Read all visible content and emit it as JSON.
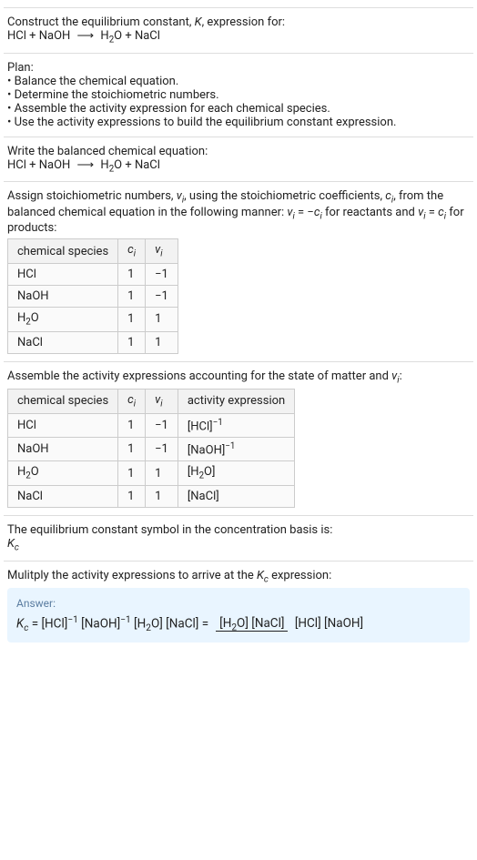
{
  "intro": {
    "line1": "Construct the equilibrium constant, ",
    "k_sym": "K",
    "line1b": ", expression for:",
    "equation_lhs_1": "HCl + NaOH",
    "equation_arrow": "⟶",
    "equation_rhs_1": "H",
    "equation_rhs_2": "2",
    "equation_rhs_3": "O + NaCl"
  },
  "plan": {
    "title": "Plan:",
    "item1": "• Balance the chemical equation.",
    "item2": "• Determine the stoichiometric numbers.",
    "item3": "• Assemble the activity expression for each chemical species.",
    "item4": "• Use the activity expressions to build the equilibrium constant expression."
  },
  "balanced": {
    "title": "Write the balanced chemical equation:",
    "lhs": "HCl + NaOH",
    "arrow": "⟶",
    "rhs_1": "H",
    "rhs_2": "2",
    "rhs_3": "O + NaCl"
  },
  "stoich": {
    "text1": "Assign stoichiometric numbers, ",
    "nu": "ν",
    "i": "i",
    "text2": ", using the stoichiometric coefficients, ",
    "c": "c",
    "text3": ", from the balanced chemical equation in the following manner: ",
    "eq1_l": "ν",
    "eq1_eq": " = −",
    "eq1_r": "c",
    "text4": " for reactants and ",
    "eq2_l": "ν",
    "eq2_eq": " = ",
    "eq2_r": "c",
    "text5": " for products:"
  },
  "table1": {
    "h1": "chemical species",
    "h2": "c",
    "h2i": "i",
    "h3": "ν",
    "h3i": "i",
    "rows": [
      {
        "sp": "HCl",
        "c": "1",
        "v": "−1"
      },
      {
        "sp": "NaOH",
        "c": "1",
        "v": "−1"
      },
      {
        "sp_h": "H",
        "sp_2": "2",
        "sp_o": "O",
        "c": "1",
        "v": "1"
      },
      {
        "sp": "NaCl",
        "c": "1",
        "v": "1"
      }
    ]
  },
  "assemble": {
    "text1": "Assemble the activity expressions accounting for the state of matter and ",
    "nu": "ν",
    "i": "i",
    "text2": ":"
  },
  "table2": {
    "h1": "chemical species",
    "h2": "c",
    "h2i": "i",
    "h3": "ν",
    "h3i": "i",
    "h4": "activity expression",
    "rows": [
      {
        "sp": "HCl",
        "c": "1",
        "v": "−1",
        "ae_base": "[HCl]",
        "ae_exp": "−1"
      },
      {
        "sp": "NaOH",
        "c": "1",
        "v": "−1",
        "ae_base": "[NaOH]",
        "ae_exp": "−1"
      },
      {
        "sp_h": "H",
        "sp_2": "2",
        "sp_o": "O",
        "c": "1",
        "v": "1",
        "ae_base": "[H",
        "ae_sub": "2",
        "ae_base2": "O]"
      },
      {
        "sp": "NaCl",
        "c": "1",
        "v": "1",
        "ae_base": "[NaCl]"
      }
    ]
  },
  "kc_symbol": {
    "text": "The equilibrium constant symbol in the concentration basis is:",
    "k": "K",
    "c": "c"
  },
  "multiply": {
    "text1": "Mulitply the activity expressions to arrive at the ",
    "k": "K",
    "c": "c",
    "text2": " expression:"
  },
  "answer": {
    "label": "Answer:",
    "k": "K",
    "c": "c",
    "eq": " = ",
    "t1": "[HCl]",
    "e1": "−1",
    "sp": " ",
    "t2": "[NaOH]",
    "e2": "−1",
    "t3": " [H",
    "t3s": "2",
    "t3b": "O] [NaCl] = ",
    "num1": "[H",
    "num1s": "2",
    "num1b": "O] [NaCl]",
    "den": "[HCl] [NaOH]"
  },
  "chart_data": {
    "type": "table",
    "tables": [
      {
        "title": "Stoichiometric numbers",
        "columns": [
          "chemical species",
          "c_i",
          "ν_i"
        ],
        "rows": [
          [
            "HCl",
            1,
            -1
          ],
          [
            "NaOH",
            1,
            -1
          ],
          [
            "H2O",
            1,
            1
          ],
          [
            "NaCl",
            1,
            1
          ]
        ]
      },
      {
        "title": "Activity expressions",
        "columns": [
          "chemical species",
          "c_i",
          "ν_i",
          "activity expression"
        ],
        "rows": [
          [
            "HCl",
            1,
            -1,
            "[HCl]^(-1)"
          ],
          [
            "NaOH",
            1,
            -1,
            "[NaOH]^(-1)"
          ],
          [
            "H2O",
            1,
            1,
            "[H2O]"
          ],
          [
            "NaCl",
            1,
            1,
            "[NaCl]"
          ]
        ]
      }
    ]
  }
}
